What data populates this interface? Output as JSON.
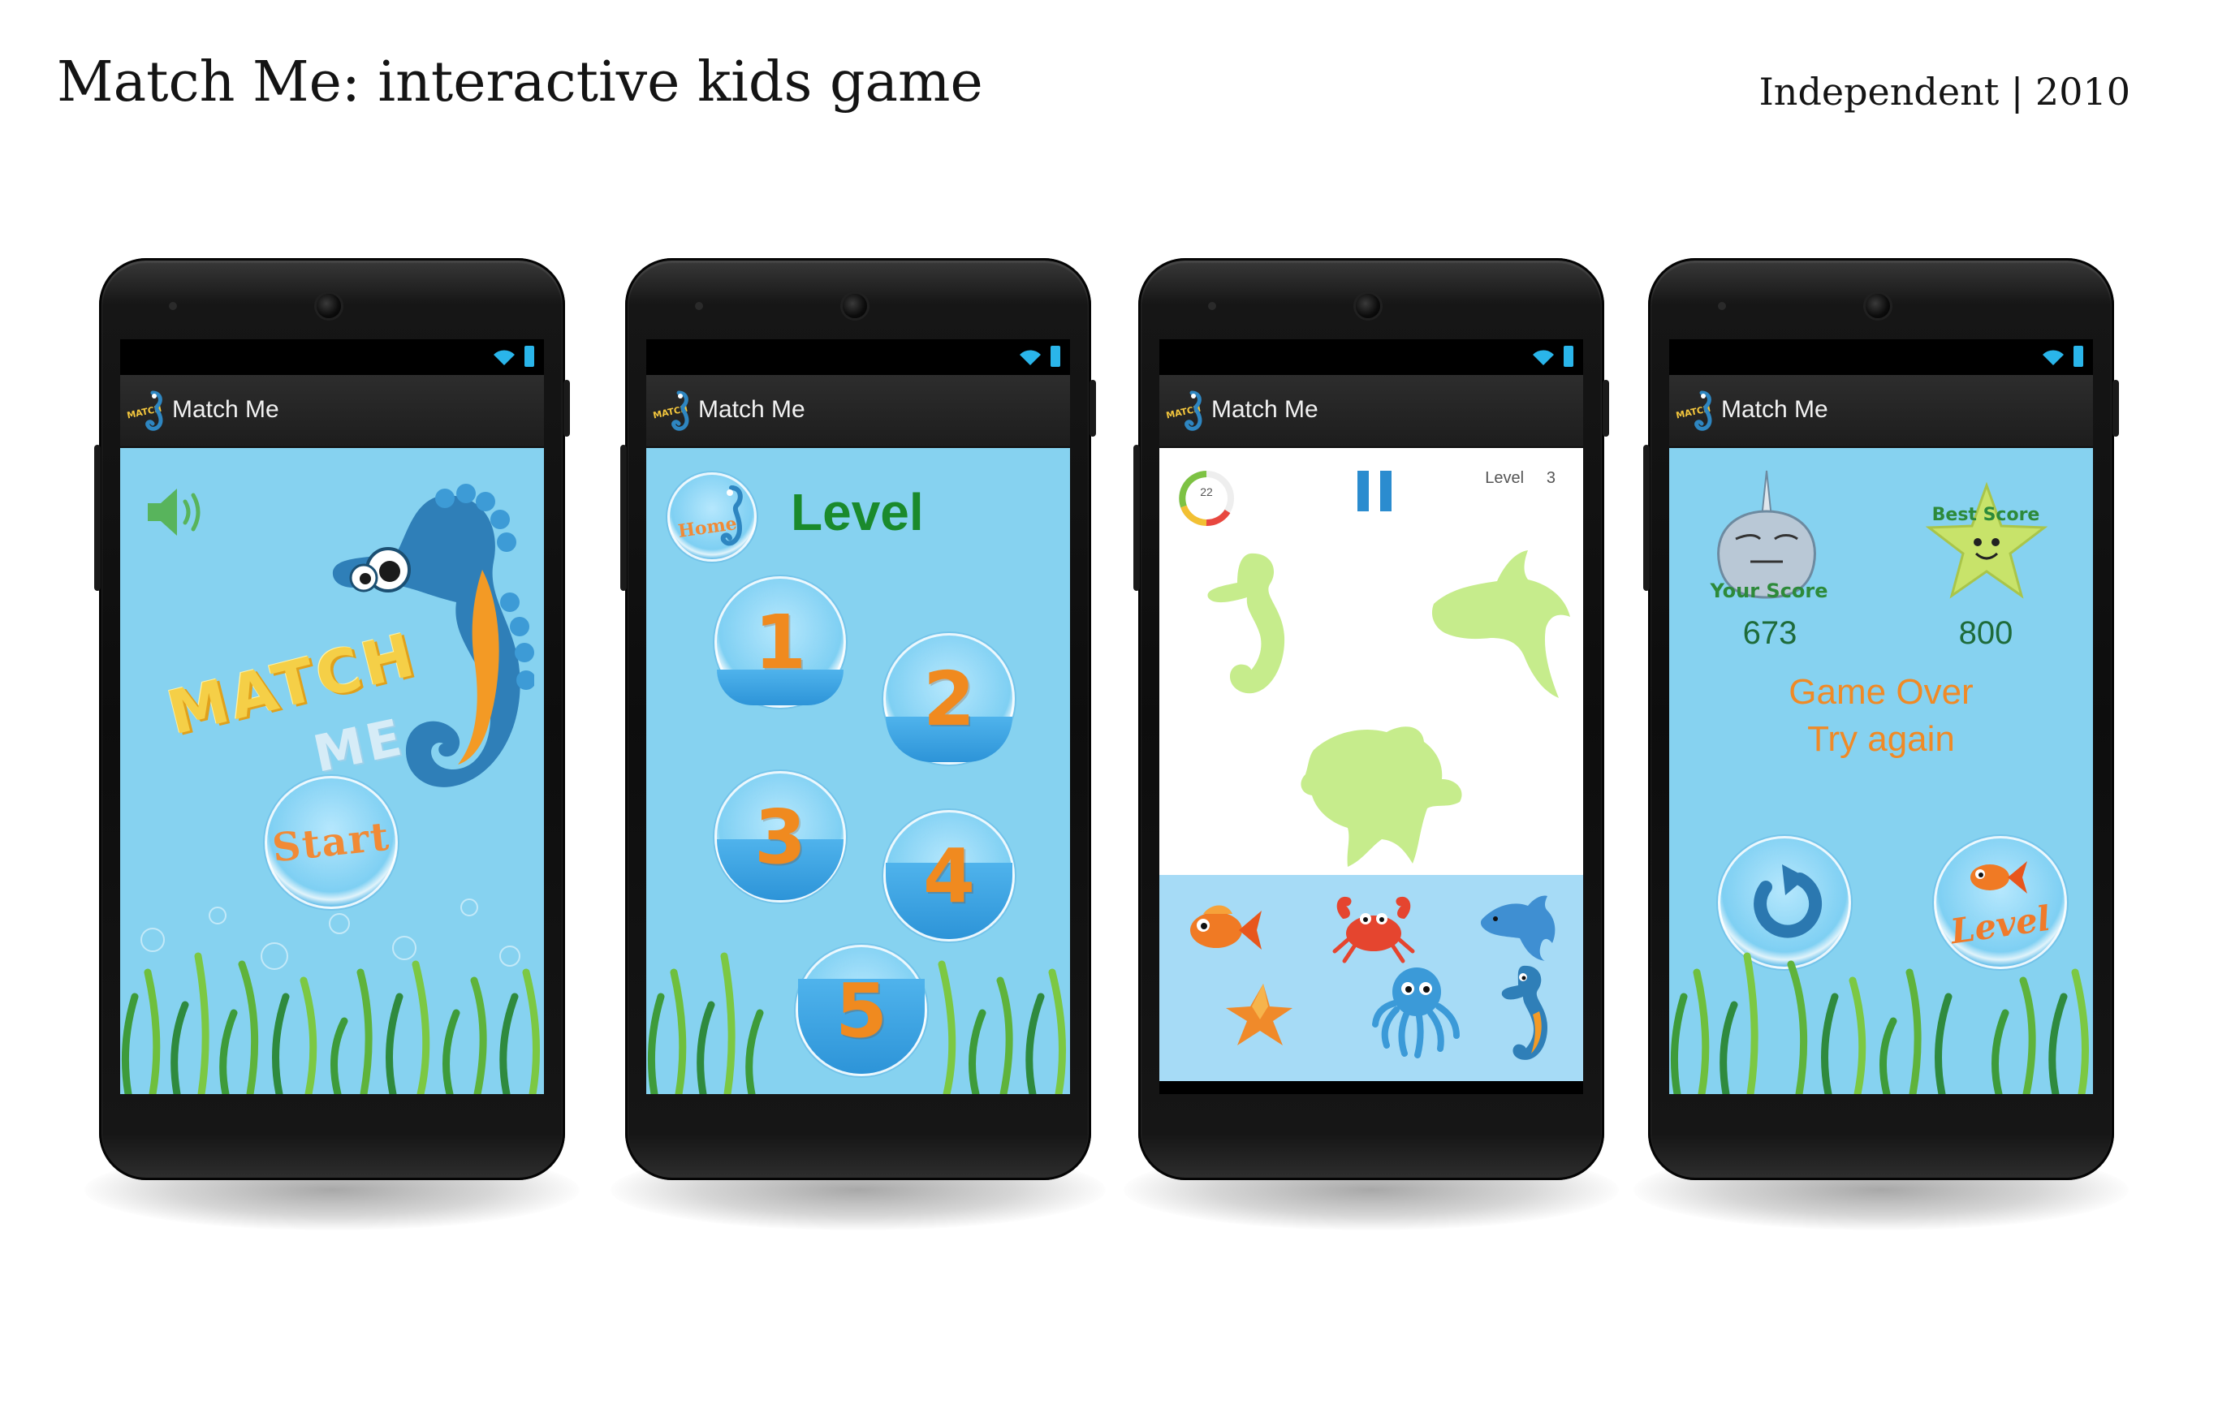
{
  "page": {
    "title": "Match Me: interactive kids game",
    "meta": "Independent | 2010"
  },
  "app": {
    "name": "Match Me"
  },
  "icons": {
    "status": [
      "wifi-icon",
      "battery-icon"
    ],
    "app_logo": "seahorse-logo-icon"
  },
  "colors": {
    "sea_background": "#86d2f0",
    "accent_orange": "#f08a1f",
    "level_green": "#1a8a2c",
    "score_green": "#1e6b3a",
    "silhouette_green": "#c6ec8c"
  },
  "screens": {
    "splash": {
      "logo_line1": "MATCH",
      "logo_line2": "ME",
      "start_button": "Start",
      "sound_icon": "speaker-icon"
    },
    "levels": {
      "title": "Level",
      "home_button": "Home",
      "level_buttons": [
        "1",
        "2",
        "3",
        "4",
        "5"
      ],
      "water_fill_levels": [
        0.28,
        0.36,
        0.48,
        0.6,
        0.75
      ]
    },
    "game": {
      "level_label": "Level",
      "level_value": "3",
      "timer_value": "22",
      "pause_icon": "pause-icon",
      "silhouettes": [
        "seahorse",
        "dolphin",
        "turtle"
      ],
      "tray_items": [
        "goldfish",
        "crab",
        "dolphin",
        "starfish",
        "octopus",
        "seahorse"
      ]
    },
    "game_over": {
      "your_score_label": "Your Score",
      "best_score_label": "Best Score",
      "your_score": "673",
      "best_score": "800",
      "message_line1": "Game Over",
      "message_line2": "Try again",
      "retry_icon": "retry-icon",
      "level_button": "Level"
    }
  }
}
